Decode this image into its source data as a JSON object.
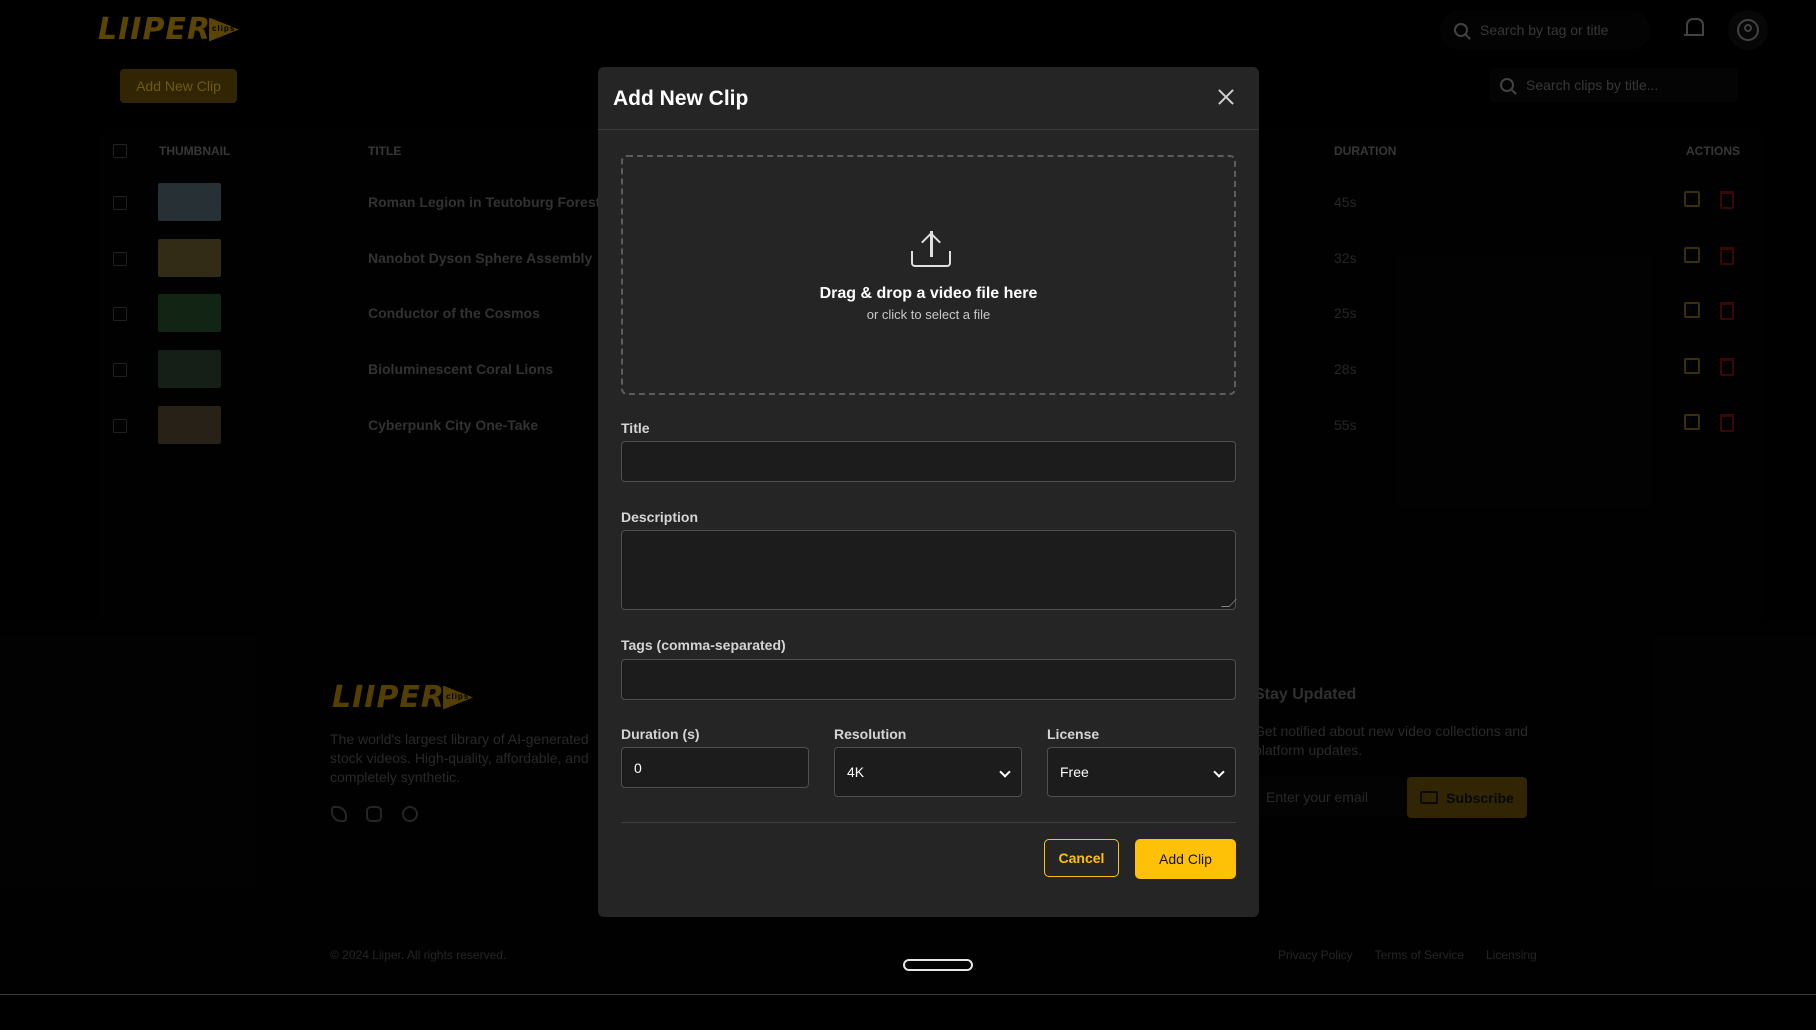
{
  "app": {
    "logo_text": "LIIPER",
    "logo_badge": "clips"
  },
  "header": {
    "search_placeholder": "Search by tag or title"
  },
  "toolbar": {
    "add_new_clip_label": "Add New Clip",
    "search_clips_placeholder": "Search clips by title..."
  },
  "table": {
    "headers": {
      "thumbnail": "THUMBNAIL",
      "title": "TITLE",
      "duration": "DURATION",
      "actions": "ACTIONS"
    },
    "rows": [
      {
        "title": "Roman Legion in Teutoburg Forest",
        "duration": "45s",
        "thumb_color": "#3b4a52"
      },
      {
        "title": "Nanobot Dyson Sphere Assembly",
        "duration": "32s",
        "thumb_color": "#4d4322"
      },
      {
        "title": "Conductor of the Cosmos",
        "duration": "25s",
        "thumb_color": "#1d3a1f"
      },
      {
        "title": "Bioluminescent Coral Lions",
        "duration": "28s",
        "thumb_color": "#223024"
      },
      {
        "title": "Cyberpunk City One-Take",
        "duration": "55s",
        "thumb_color": "#3c3426"
      }
    ]
  },
  "footer": {
    "description": "The world's largest library of AI-generated stock videos. High-quality, affordable, and completely synthetic.",
    "stay_title": "Stay Updated",
    "stay_desc": "Get notified about new video collections and platform updates.",
    "email_placeholder": "Enter your email",
    "subscribe_label": "Subscribe",
    "copyright": "© 2024 Liiper. All rights reserved.",
    "links": [
      "Privacy Policy",
      "Terms of Service",
      "Licensing"
    ]
  },
  "modal": {
    "title": "Add New Clip",
    "dropzone_main": "Drag & drop a video file here",
    "dropzone_sub": "or click to select a file",
    "title_label": "Title",
    "title_value": "",
    "description_label": "Description",
    "description_value": "",
    "tags_label": "Tags (comma-separated)",
    "tags_value": "",
    "duration_label": "Duration (s)",
    "duration_value": "0",
    "resolution_label": "Resolution",
    "resolution_value": "4K",
    "license_label": "License",
    "license_value": "Free",
    "cancel_label": "Cancel",
    "submit_label": "Add Clip"
  },
  "colors": {
    "accent": "#ffc107",
    "modal_bg": "#252525",
    "field_bg": "#1c1c1c",
    "delete_red": "#8b1a1a"
  }
}
